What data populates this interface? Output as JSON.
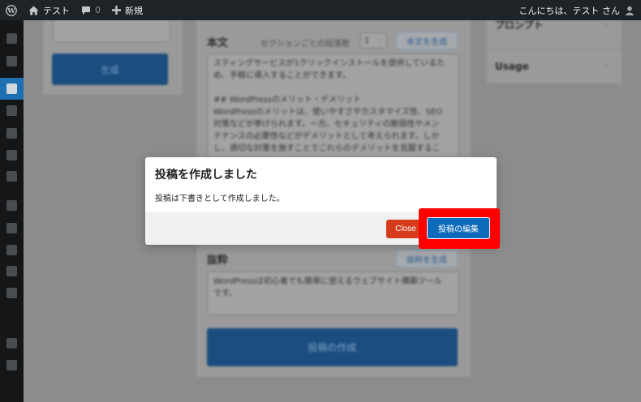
{
  "adminbar": {
    "site_name": "テスト",
    "comments_count": "0",
    "new_label": "新規",
    "greeting": "こんにちは、テスト さん"
  },
  "left_panel": {
    "generate_button": "生成"
  },
  "body_section": {
    "heading": "本文",
    "section_count_label": "セクションごとの段落数",
    "section_count_value": "1",
    "generate_body_button": "本文を生成",
    "text": "スティングサービスが1クリックインストールを提供しているた\nめ、手軽に導入することができます。\n\n## WordPressのメリット・デメリット\nWordPressのメリットは、使いやすさやカスタマイズ性、SEO\n対策などが挙げられます。一方、セキュリティの脆弱性やメン\nテナンスの必要性などがデメリットとして考えられます。しか\nし、適切な対策を施すことでこれらのデメリットを克服するこ"
  },
  "summary_section": {
    "heading": "抜粋",
    "generate_summary_button": "抜粋を生成",
    "text": "WordPressは初心者でも簡単に使えるウェブサイト構築ツール\nです。"
  },
  "create_post_button": "投稿の作成",
  "right_panels": {
    "prompt_title": "プロンプト",
    "usage_title": "Usage"
  },
  "modal": {
    "title": "投稿を作成しました",
    "message": "投稿は下書きとして作成しました。",
    "close_label": "Close",
    "edit_label": "投稿の編集"
  },
  "colors": {
    "accent": "#0e6bbb",
    "close": "#d63c1c",
    "highlight": "#ff0000",
    "adminbar": "#1d2327"
  }
}
